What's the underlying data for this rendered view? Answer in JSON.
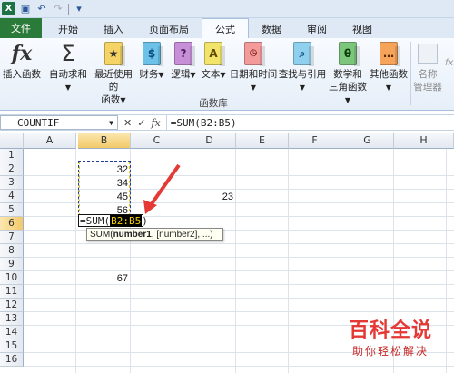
{
  "app_icon": "excel-icon",
  "quick_access": [
    "save-icon",
    "undo-icon",
    "redo-icon",
    "customize-icon"
  ],
  "tabs": [
    {
      "label": "文件"
    },
    {
      "label": "开始"
    },
    {
      "label": "插入"
    },
    {
      "label": "页面布局"
    },
    {
      "label": "公式"
    },
    {
      "label": "数据"
    },
    {
      "label": "审阅"
    },
    {
      "label": "视图"
    }
  ],
  "ribbon": {
    "insert_function": "插入函数",
    "autosum_line1": "自动求和",
    "recent_line1": "最近使用的",
    "recent_line2": "函数",
    "financial": "财务",
    "logical": "逻辑",
    "text": "文本",
    "datetime": "日期和时间",
    "lookup": "查找与引用",
    "math_line1": "数学和",
    "math_line2": "三角函数",
    "more": "其他函数",
    "name_mgr_line1": "名称",
    "name_mgr_line2": "管理器",
    "group_label": "函数库"
  },
  "formula_bar": {
    "name_box": "COUNTIF",
    "formula": "=SUM(B2:B5)"
  },
  "columns": [
    "A",
    "B",
    "C",
    "D",
    "E",
    "F",
    "G",
    "H"
  ],
  "rows": [
    "1",
    "2",
    "3",
    "4",
    "5",
    "6",
    "7",
    "8",
    "9",
    "10",
    "11",
    "12",
    "13",
    "14",
    "15",
    "16"
  ],
  "cells": {
    "B2": "32",
    "B3": "34",
    "B4": "45",
    "B5": "56",
    "D4": "23",
    "B10": "67"
  },
  "edit_cell": {
    "prefix": "=SUM(",
    "ref": "B2:B5",
    "suffix": ")"
  },
  "tooltip": {
    "fn": "SUM(",
    "arg1": "number1",
    "rest": ", [number2], ...)"
  },
  "watermark": {
    "title": "百科全说",
    "subtitle": "助你轻松解决"
  },
  "colors": {
    "file_tab": "#2a7a3a",
    "selected_header": "#f3c96a",
    "annotation_arrow": "#e53935",
    "watermark": "#e53935"
  }
}
